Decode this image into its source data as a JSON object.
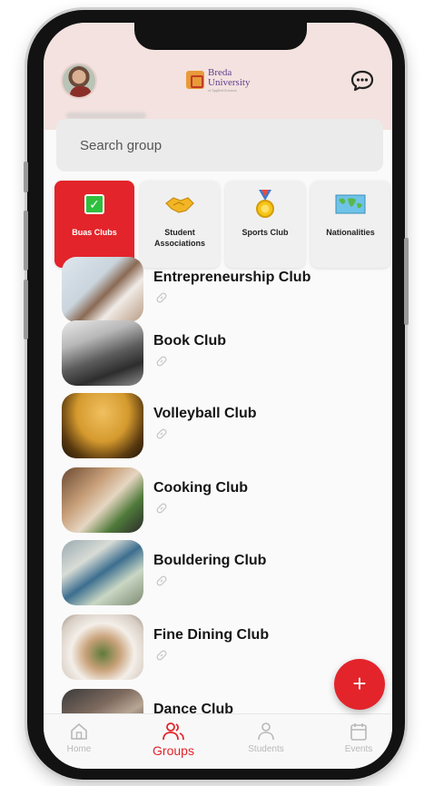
{
  "app": {
    "logo_line1": "Breda",
    "logo_line2": "University",
    "logo_line3": "of Applied Sciences"
  },
  "icons": {
    "avatar": "profile-avatar",
    "chat": "chat-bubble-icon",
    "link": "link-icon",
    "add": "plus-icon"
  },
  "search": {
    "placeholder": "Search group"
  },
  "categories": [
    {
      "label": "Buas Clubs",
      "icon": "checkbox-icon",
      "active": true
    },
    {
      "label": "Student Associations",
      "icon": "handshake-icon",
      "active": false
    },
    {
      "label": "Sports Club",
      "icon": "medal-icon",
      "active": false
    },
    {
      "label": "Nationalities",
      "icon": "world-map-icon",
      "active": false
    }
  ],
  "groups": [
    {
      "name": "Entrepreneurship Club"
    },
    {
      "name": "Book Club"
    },
    {
      "name": "Volleyball Club"
    },
    {
      "name": "Cooking Club"
    },
    {
      "name": "Bouldering Club"
    },
    {
      "name": "Fine Dining Club"
    },
    {
      "name": "Dance Club"
    }
  ],
  "fab": {
    "label": "+"
  },
  "nav": [
    {
      "label": "Home",
      "icon": "home-icon",
      "active": false
    },
    {
      "label": "Groups",
      "icon": "groups-icon",
      "active": true
    },
    {
      "label": "Students",
      "icon": "person-icon",
      "active": false
    },
    {
      "label": "Events",
      "icon": "calendar-icon",
      "active": false
    }
  ],
  "colors": {
    "accent": "#e3242b",
    "header_bg": "#f3e2df",
    "inactive": "#b8b8b8"
  }
}
